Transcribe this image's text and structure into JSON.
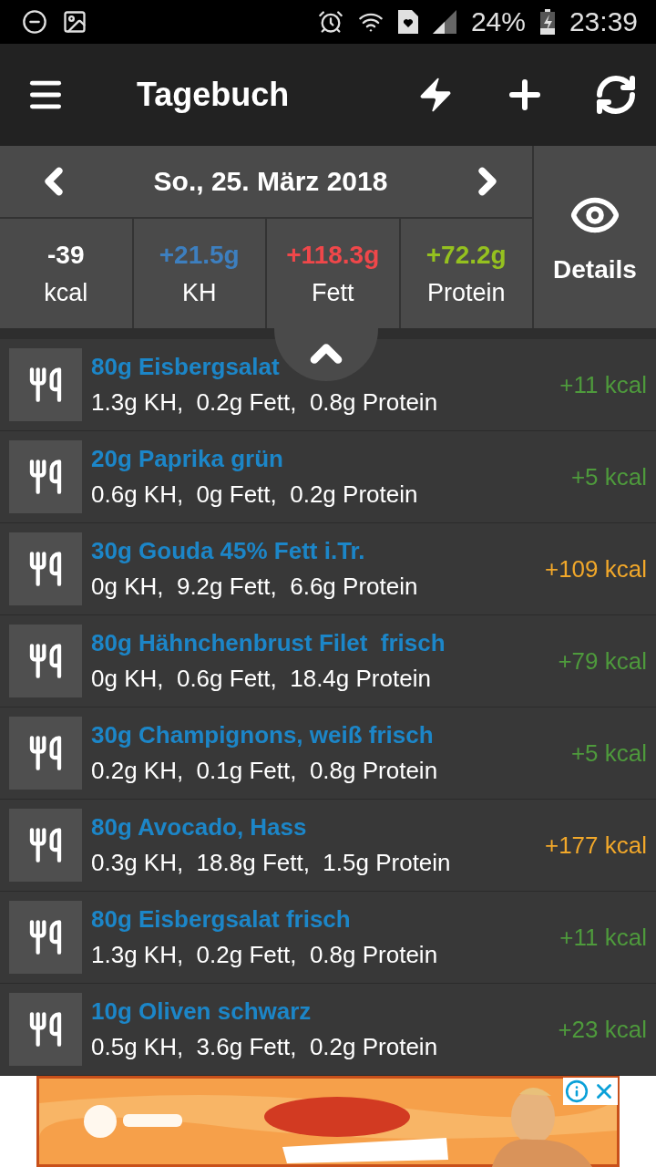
{
  "status_bar": {
    "battery": "24%",
    "time": "23:39"
  },
  "toolbar": {
    "title": "Tagebuch"
  },
  "date_nav": {
    "date": "So., 25. März 2018"
  },
  "summary": [
    {
      "value": "-39",
      "label": "kcal",
      "color": "#ffffff"
    },
    {
      "value": "+21.5g",
      "label": "KH",
      "color": "#3d7fbf"
    },
    {
      "value": "+118.3g",
      "label": "Fett",
      "color": "#f0474a"
    },
    {
      "value": "+72.2g",
      "label": "Protein",
      "color": "#95c11f"
    }
  ],
  "details_button": {
    "label": "Details"
  },
  "entries": [
    {
      "name": "80g Eisbergsalat",
      "nutrients": "1.3g KH,  0.2g Fett,  0.8g Protein",
      "kcal": "+11 kcal",
      "color": "#4e9a3c"
    },
    {
      "name": "20g Paprika grün",
      "nutrients": "0.6g KH,  0g Fett,  0.2g Protein",
      "kcal": "+5 kcal",
      "color": "#4e9a3c"
    },
    {
      "name": "30g Gouda 45% Fett i.Tr.",
      "nutrients": "0g KH,  9.2g Fett,  6.6g Protein",
      "kcal": "+109 kcal",
      "color": "#f2a82a"
    },
    {
      "name": "80g Hähnchenbrust Filet  frisch",
      "nutrients": "0g KH,  0.6g Fett,  18.4g Protein",
      "kcal": "+79 kcal",
      "color": "#4e9a3c"
    },
    {
      "name": "30g Champignons, weiß frisch",
      "nutrients": "0.2g KH,  0.1g Fett,  0.8g Protein",
      "kcal": "+5 kcal",
      "color": "#4e9a3c"
    },
    {
      "name": "80g Avocado, Hass",
      "nutrients": "0.3g KH,  18.8g Fett,  1.5g Protein",
      "kcal": "+177 kcal",
      "color": "#f2a82a"
    },
    {
      "name": "80g Eisbergsalat frisch",
      "nutrients": "1.3g KH,  0.2g Fett,  0.8g Protein",
      "kcal": "+11 kcal",
      "color": "#4e9a3c"
    },
    {
      "name": "10g Oliven schwarz",
      "nutrients": "0.5g KH,  3.6g Fett,  0.2g Protein",
      "kcal": "+23 kcal",
      "color": "#4e9a3c"
    }
  ]
}
